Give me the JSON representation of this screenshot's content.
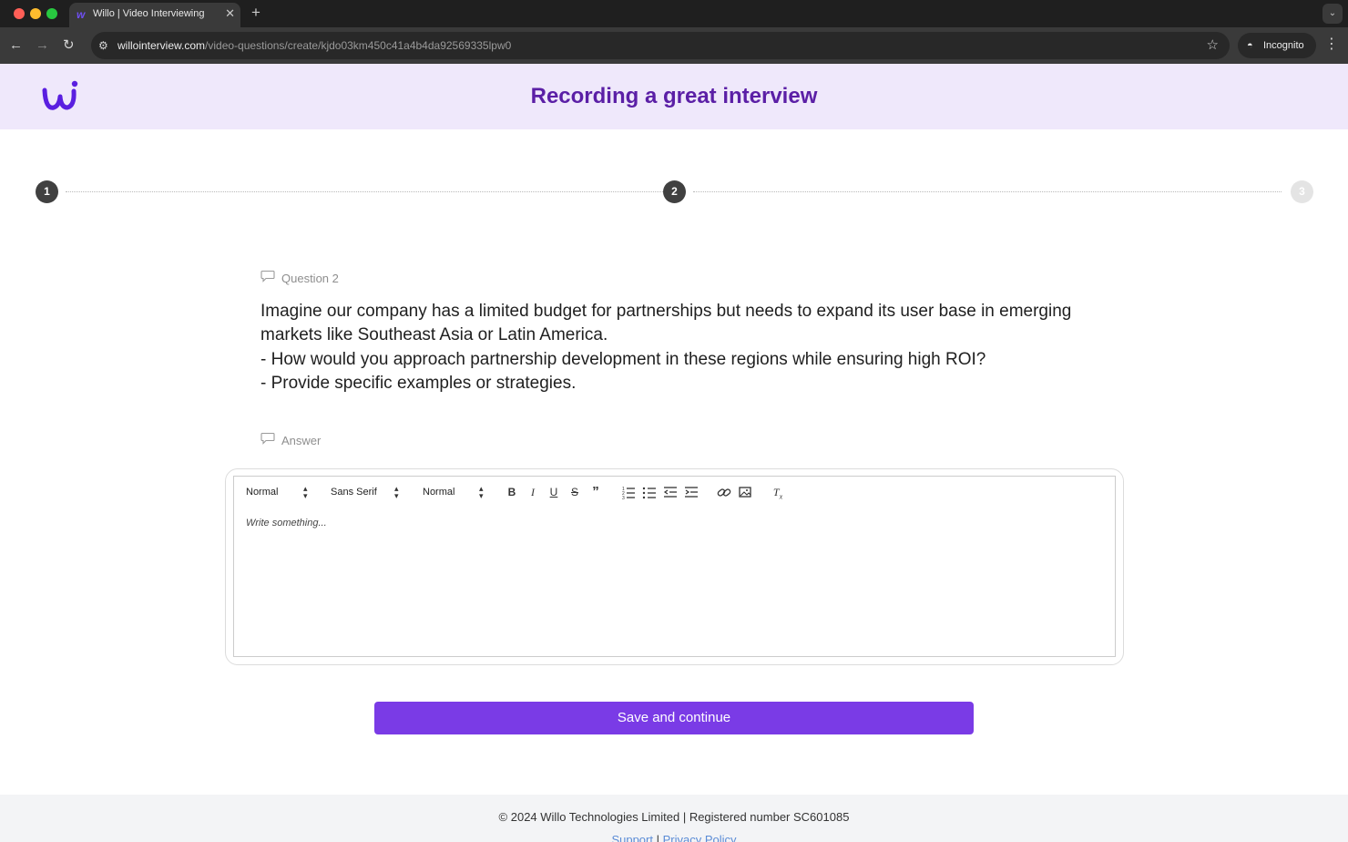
{
  "browser": {
    "tab_title": "Willo | Video Interviewing",
    "tab_favicon": "willo-logo-icon",
    "url_host": "willointerview.com",
    "url_path": "/video-questions/create/kjdo03km450c41a4b4da92569335lpw0",
    "incognito_label": "Incognito"
  },
  "header": {
    "title": "Recording a great interview",
    "logo": "willo-logo"
  },
  "stepper": {
    "steps": [
      {
        "number": "1",
        "state": "completed"
      },
      {
        "number": "2",
        "state": "current"
      },
      {
        "number": "3",
        "state": "upcoming"
      }
    ]
  },
  "question": {
    "label": "Question 2",
    "lines": [
      "Imagine our company has a limited budget for partnerships but needs to expand its user base in emerging",
      "markets like Southeast Asia or Latin America.",
      "- How would you approach partnership development in these regions while ensuring high ROI?",
      "- Provide specific examples or strategies."
    ]
  },
  "answer": {
    "label": "Answer",
    "editor": {
      "heading_select": "Normal",
      "font_select": "Sans Serif",
      "size_select": "Normal",
      "placeholder": "Write something..."
    }
  },
  "actions": {
    "save_label": "Save and continue"
  },
  "footer": {
    "copyright": "© 2024 Willo Technologies Limited | Registered number SC601085",
    "support_link": "Support",
    "separator": "|",
    "privacy_link": "Privacy Policy"
  },
  "colors": {
    "brand_purple": "#7a3be6",
    "title_purple": "#5b1fa6",
    "header_bg": "#efe8fb"
  }
}
